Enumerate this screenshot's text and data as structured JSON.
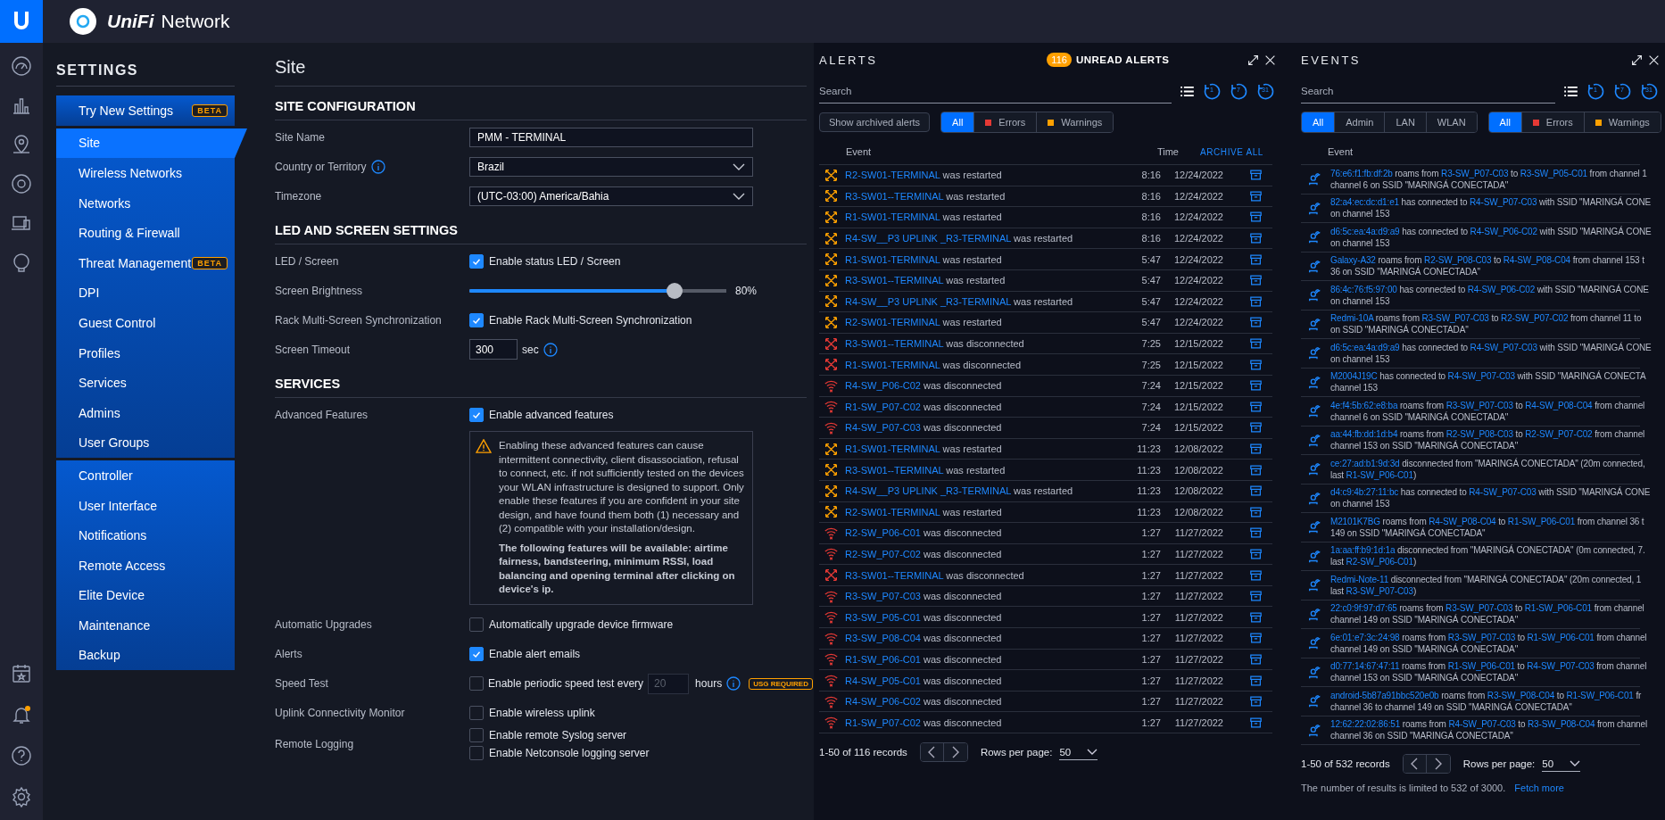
{
  "app": {
    "brand": "UniFi",
    "product": "Network"
  },
  "settings": {
    "title": "SETTINGS",
    "groups": [
      [
        {
          "label": "Try New Settings",
          "selected": false,
          "badge": "BETA"
        }
      ],
      [
        {
          "label": "Site",
          "selected": true
        },
        {
          "label": "Wireless Networks",
          "selected": false
        },
        {
          "label": "Networks",
          "selected": false
        },
        {
          "label": "Routing & Firewall",
          "selected": false
        },
        {
          "label": "Threat Management",
          "selected": false,
          "badge": "BETA"
        },
        {
          "label": "DPI",
          "selected": false
        },
        {
          "label": "Guest Control",
          "selected": false
        },
        {
          "label": "Profiles",
          "selected": false
        },
        {
          "label": "Services",
          "selected": false
        },
        {
          "label": "Admins",
          "selected": false
        },
        {
          "label": "User Groups",
          "selected": false
        }
      ],
      [
        {
          "label": "Controller",
          "selected": false
        },
        {
          "label": "User Interface",
          "selected": false
        },
        {
          "label": "Notifications",
          "selected": false
        },
        {
          "label": "Remote Access",
          "selected": false
        },
        {
          "label": "Elite Device",
          "selected": false
        },
        {
          "label": "Maintenance",
          "selected": false
        },
        {
          "label": "Backup",
          "selected": false
        }
      ]
    ]
  },
  "page": {
    "title": "Site",
    "sections": [
      {
        "title": "SITE CONFIGURATION",
        "rows": [
          {
            "kind": "text",
            "label": "Site Name",
            "value": "PMM - TERMINAL"
          },
          {
            "kind": "select",
            "label": "Country or Territory",
            "info": true,
            "value": "Brazil"
          },
          {
            "kind": "select",
            "label": "Timezone",
            "value": "(UTC-03:00) America/Bahia"
          }
        ]
      },
      {
        "title": "LED AND SCREEN SETTINGS",
        "rows": [
          {
            "kind": "checkbox",
            "label": "LED / Screen",
            "items": [
              {
                "text": "Enable status LED / Screen",
                "checked": true
              }
            ]
          },
          {
            "kind": "slider",
            "label": "Screen Brightness",
            "level": 0.8,
            "reading": "80%"
          },
          {
            "kind": "checkbox",
            "label": "Rack Multi-Screen Synchronization",
            "items": [
              {
                "text": "Enable Rack Multi-Screen Synchronization",
                "checked": true
              }
            ]
          },
          {
            "kind": "number",
            "label": "Screen Timeout",
            "value": "300",
            "unit": "sec",
            "info": true
          }
        ]
      },
      {
        "title": "SERVICES",
        "rows": [
          {
            "kind": "checkbox",
            "label": "Advanced Features",
            "items": [
              {
                "text": "Enable advanced features",
                "checked": true
              }
            ]
          },
          {
            "kind": "warning",
            "paragraphs": [
              {
                "text": "Enabling these advanced features can cause intermittent connectivity, client disassociation, refusal to connect, etc. if not sufficiently tested on the devices your WLAN infrastructure is designed to support. Only enable these features if you are confident in your site design, and have found them both (1) necessary and (2) compatible with your installation/design.",
                "strong": false
              },
              {
                "text": "The following features will be available: airtime fairness, bandsteering, minimum RSSI, load balancing and opening terminal after clicking on device's ip.",
                "strong": true
              }
            ]
          },
          {
            "kind": "checkbox",
            "label": "Automatic Upgrades",
            "items": [
              {
                "text": "Automatically upgrade device firmware",
                "checked": false
              }
            ]
          },
          {
            "kind": "checkbox",
            "label": "Alerts",
            "items": [
              {
                "text": "Enable alert emails",
                "checked": true
              }
            ]
          },
          {
            "kind": "speedtest",
            "label": "Speed Test",
            "checked": false,
            "text": "Enable periodic speed test every",
            "value": "20",
            "disabled": true,
            "unit": "hours",
            "info": true,
            "badge": "USG REQUIRED"
          },
          {
            "kind": "checkbox",
            "label": "Uplink Connectivity Monitor",
            "items": [
              {
                "text": "Enable wireless uplink",
                "checked": false
              }
            ]
          },
          {
            "kind": "checkbox",
            "label": "Remote Logging",
            "items": [
              {
                "text": "Enable remote Syslog server",
                "checked": false
              },
              {
                "text": "Enable Netconsole logging server",
                "checked": false
              }
            ]
          }
        ]
      }
    ]
  },
  "alerts": {
    "title": "ALERTS",
    "unread_count": "116",
    "unread_label": "UNREAD ALERTS",
    "search": {
      "placeholder": "Search"
    },
    "ranges": [
      "1",
      "7",
      "31"
    ],
    "archived_button": "Show archived alerts",
    "filters": [
      {
        "label": "All",
        "selected": true
      },
      {
        "label": "Errors",
        "selected": false,
        "color": "#e53935"
      },
      {
        "label": "Warnings",
        "selected": false,
        "color": "#ffa000"
      }
    ],
    "columns": [
      "Event",
      "Time"
    ],
    "archive_all": "ARCHIVE ALL",
    "rows": [
      {
        "kind": "restart",
        "device": "R2-SW01-TERMINAL",
        "text": " was restarted",
        "time": "8:16",
        "date": "12/24/2022"
      },
      {
        "kind": "restart",
        "device": "R3-SW01--TERMINAL",
        "text": " was restarted",
        "time": "8:16",
        "date": "12/24/2022"
      },
      {
        "kind": "restart",
        "device": "R1-SW01-TERMINAL",
        "text": " was restarted",
        "time": "8:16",
        "date": "12/24/2022"
      },
      {
        "kind": "restart",
        "device": "R4-SW__P3 UPLINK _R3-TERMINAL",
        "text": " was restarted",
        "time": "8:16",
        "date": "12/24/2022"
      },
      {
        "kind": "restart",
        "device": "R1-SW01-TERMINAL",
        "text": " was restarted",
        "time": "5:47",
        "date": "12/24/2022"
      },
      {
        "kind": "restart",
        "device": "R3-SW01--TERMINAL",
        "text": " was restarted",
        "time": "5:47",
        "date": "12/24/2022"
      },
      {
        "kind": "restart",
        "device": "R4-SW__P3 UPLINK _R3-TERMINAL",
        "text": " was restarted",
        "time": "5:47",
        "date": "12/24/2022"
      },
      {
        "kind": "restart",
        "device": "R2-SW01-TERMINAL",
        "text": " was restarted",
        "time": "5:47",
        "date": "12/24/2022"
      },
      {
        "kind": "disconnect",
        "device": "R3-SW01--TERMINAL",
        "text": " was disconnected",
        "time": "7:25",
        "date": "12/15/2022"
      },
      {
        "kind": "disconnect",
        "device": "R1-SW01-TERMINAL",
        "text": " was disconnected",
        "time": "7:25",
        "date": "12/15/2022"
      },
      {
        "kind": "wifi",
        "device": "R4-SW_P06-C02",
        "text": " was disconnected",
        "time": "7:24",
        "date": "12/15/2022"
      },
      {
        "kind": "wifi",
        "device": "R1-SW_P07-C02",
        "text": " was disconnected",
        "time": "7:24",
        "date": "12/15/2022"
      },
      {
        "kind": "wifi",
        "device": "R4-SW_P07-C03",
        "text": " was disconnected",
        "time": "7:24",
        "date": "12/15/2022"
      },
      {
        "kind": "restart",
        "device": "R1-SW01-TERMINAL",
        "text": " was restarted",
        "time": "11:23",
        "date": "12/08/2022"
      },
      {
        "kind": "restart",
        "device": "R3-SW01--TERMINAL",
        "text": " was restarted",
        "time": "11:23",
        "date": "12/08/2022"
      },
      {
        "kind": "restart",
        "device": "R4-SW__P3 UPLINK _R3-TERMINAL",
        "text": " was restarted",
        "time": "11:23",
        "date": "12/08/2022"
      },
      {
        "kind": "restart",
        "device": "R2-SW01-TERMINAL",
        "text": " was restarted",
        "time": "11:23",
        "date": "12/08/2022"
      },
      {
        "kind": "wifi",
        "device": "R2-SW_P06-C01",
        "text": " was disconnected",
        "time": "1:27",
        "date": "11/27/2022"
      },
      {
        "kind": "wifi",
        "device": "R2-SW_P07-C02",
        "text": " was disconnected",
        "time": "1:27",
        "date": "11/27/2022"
      },
      {
        "kind": "disconnect",
        "device": "R3-SW01--TERMINAL",
        "text": " was disconnected",
        "time": "1:27",
        "date": "11/27/2022"
      },
      {
        "kind": "wifi",
        "device": "R3-SW_P07-C03",
        "text": " was disconnected",
        "time": "1:27",
        "date": "11/27/2022"
      },
      {
        "kind": "wifi",
        "device": "R3-SW_P05-C01",
        "text": " was disconnected",
        "time": "1:27",
        "date": "11/27/2022"
      },
      {
        "kind": "wifi",
        "device": "R3-SW_P08-C04",
        "text": " was disconnected",
        "time": "1:27",
        "date": "11/27/2022"
      },
      {
        "kind": "wifi",
        "device": "R1-SW_P06-C01",
        "text": " was disconnected",
        "time": "1:27",
        "date": "11/27/2022"
      },
      {
        "kind": "wifi",
        "device": "R4-SW_P05-C01",
        "text": " was disconnected",
        "time": "1:27",
        "date": "11/27/2022"
      },
      {
        "kind": "wifi",
        "device": "R4-SW_P06-C02",
        "text": " was disconnected",
        "time": "1:27",
        "date": "11/27/2022"
      },
      {
        "kind": "wifi",
        "device": "R1-SW_P07-C02",
        "text": " was disconnected",
        "time": "1:27",
        "date": "11/27/2022"
      }
    ],
    "footer": {
      "records": "1-50 of 116 records",
      "rows_label": "Rows per page:",
      "rows_value": "50"
    }
  },
  "events": {
    "title": "EVENTS",
    "search": {
      "placeholder": "Search"
    },
    "ranges": [
      "1",
      "7",
      "31"
    ],
    "categories": [
      {
        "label": "All",
        "selected": true
      },
      {
        "label": "Admin",
        "selected": false
      },
      {
        "label": "LAN",
        "selected": false
      },
      {
        "label": "WLAN",
        "selected": false
      }
    ],
    "severities": [
      {
        "label": "All",
        "selected": true
      },
      {
        "label": "Errors",
        "selected": false,
        "color": "#e53935"
      },
      {
        "label": "Warnings",
        "selected": false,
        "color": "#ffa000"
      }
    ],
    "columns": [
      "Event"
    ],
    "rows": [
      {
        "lines": [
          [
            {
              "link": "76:e6:f1:fb:df:2b"
            },
            {
              "text": " roams from "
            },
            {
              "link": "R3-SW_P07-C03"
            },
            {
              "text": " to "
            },
            {
              "link": "R3-SW_P05-C01"
            },
            {
              "text": " from channel 1"
            }
          ],
          [
            {
              "text": "channel 6 on SSID \"MARINGÁ CONECTADA\""
            }
          ]
        ]
      },
      {
        "lines": [
          [
            {
              "link": "82:a4:ec:dc:d1:e1"
            },
            {
              "text": " has connected to "
            },
            {
              "link": "R4-SW_P07-C03"
            },
            {
              "text": " with SSID \"MARINGÁ CONE"
            }
          ],
          [
            {
              "text": "on channel 153"
            }
          ]
        ]
      },
      {
        "lines": [
          [
            {
              "link": "d6:5c:ea:4a:d9:a9"
            },
            {
              "text": " has connected to "
            },
            {
              "link": "R4-SW_P06-C02"
            },
            {
              "text": " with SSID \"MARINGÁ CONE"
            }
          ],
          [
            {
              "text": "on channel 153"
            }
          ]
        ]
      },
      {
        "lines": [
          [
            {
              "link": "Galaxy-A32"
            },
            {
              "text": " roams from "
            },
            {
              "link": "R2-SW_P08-C03"
            },
            {
              "text": " to "
            },
            {
              "link": "R4-SW_P08-C04"
            },
            {
              "text": " from channel 153 t"
            }
          ],
          [
            {
              "text": "36 on SSID \"MARINGÁ CONECTADA\""
            }
          ]
        ]
      },
      {
        "lines": [
          [
            {
              "link": "86:4c:76:f5:97:00"
            },
            {
              "text": " has connected to "
            },
            {
              "link": "R4-SW_P06-C02"
            },
            {
              "text": " with SSID \"MARINGÁ CONE"
            }
          ],
          [
            {
              "text": "on channel 153"
            }
          ]
        ]
      },
      {
        "lines": [
          [
            {
              "link": "Redmi-10A"
            },
            {
              "text": " roams from "
            },
            {
              "link": "R3-SW_P07-C03"
            },
            {
              "text": " to "
            },
            {
              "link": "R2-SW_P07-C02"
            },
            {
              "text": " from channel 11 to"
            }
          ],
          [
            {
              "text": "on SSID \"MARINGÁ CONECTADA\""
            }
          ]
        ]
      },
      {
        "lines": [
          [
            {
              "link": "d6:5c:ea:4a:d9:a9"
            },
            {
              "text": " has connected to "
            },
            {
              "link": "R4-SW_P07-C03"
            },
            {
              "text": " with SSID \"MARINGÁ CONE"
            }
          ],
          [
            {
              "text": "on channel 153"
            }
          ]
        ]
      },
      {
        "lines": [
          [
            {
              "link": "M2004J19C"
            },
            {
              "text": " has connected to "
            },
            {
              "link": "R4-SW_P07-C03"
            },
            {
              "text": " with SSID \"MARINGÁ CONECTA"
            }
          ],
          [
            {
              "text": "channel 153"
            }
          ]
        ]
      },
      {
        "lines": [
          [
            {
              "link": "4e:f4:5b:62:e8:ba"
            },
            {
              "text": " roams from "
            },
            {
              "link": "R3-SW_P07-C03"
            },
            {
              "text": " to "
            },
            {
              "link": "R4-SW_P08-C04"
            },
            {
              "text": " from channel"
            }
          ],
          [
            {
              "text": "channel 6 on SSID \"MARINGÁ CONECTADA\""
            }
          ]
        ]
      },
      {
        "lines": [
          [
            {
              "link": "aa:44:fb:dd:1d:b4"
            },
            {
              "text": " roams from "
            },
            {
              "link": "R2-SW_P08-C03"
            },
            {
              "text": " to "
            },
            {
              "link": "R2-SW_P07-C02"
            },
            {
              "text": " from channel"
            }
          ],
          [
            {
              "text": "channel 153 on SSID \"MARINGÁ CONECTADA\""
            }
          ]
        ]
      },
      {
        "lines": [
          [
            {
              "link": "ce:27:ad:b1:9d:3d"
            },
            {
              "text": " disconnected from \"MARINGÁ CONECTADA\" (20m connected,"
            }
          ],
          [
            {
              "text": "last "
            },
            {
              "link": "R1-SW_P06-C01"
            },
            {
              "text": ")"
            }
          ]
        ]
      },
      {
        "lines": [
          [
            {
              "link": "d4:c9:4b:27:11:bc"
            },
            {
              "text": " has connected to "
            },
            {
              "link": "R4-SW_P07-C03"
            },
            {
              "text": " with SSID \"MARINGÁ CONE"
            }
          ],
          [
            {
              "text": "on channel 153"
            }
          ]
        ]
      },
      {
        "lines": [
          [
            {
              "link": "M2101K7BG"
            },
            {
              "text": " roams from "
            },
            {
              "link": "R4-SW_P08-C04"
            },
            {
              "text": " to "
            },
            {
              "link": "R1-SW_P06-C01"
            },
            {
              "text": " from channel 36 t"
            }
          ],
          [
            {
              "text": "149 on SSID \"MARINGÁ CONECTADA\""
            }
          ]
        ]
      },
      {
        "lines": [
          [
            {
              "link": "1a:aa:ff:b9:1d:1a"
            },
            {
              "text": " disconnected from \"MARINGÁ CONECTADA\" (0m connected, 7."
            }
          ],
          [
            {
              "text": "last "
            },
            {
              "link": "R2-SW_P06-C01"
            },
            {
              "text": ")"
            }
          ]
        ]
      },
      {
        "lines": [
          [
            {
              "link": "Redmi-Note-11"
            },
            {
              "text": " disconnected from \"MARINGÁ CONECTADA\" (20m connected, 1"
            }
          ],
          [
            {
              "text": "last "
            },
            {
              "link": "R3-SW_P07-C03"
            },
            {
              "text": ")"
            }
          ]
        ]
      },
      {
        "lines": [
          [
            {
              "link": "22:c0:9f:97:d7:65"
            },
            {
              "text": " roams from "
            },
            {
              "link": "R3-SW_P07-C03"
            },
            {
              "text": " to "
            },
            {
              "link": "R1-SW_P06-C01"
            },
            {
              "text": " from channel"
            }
          ],
          [
            {
              "text": "channel 149 on SSID \"MARINGÁ CONECTADA\""
            }
          ]
        ]
      },
      {
        "lines": [
          [
            {
              "link": "6e:01:e7:3c:24:98"
            },
            {
              "text": " roams from "
            },
            {
              "link": "R3-SW_P07-C03"
            },
            {
              "text": " to "
            },
            {
              "link": "R1-SW_P06-C01"
            },
            {
              "text": " from channel"
            }
          ],
          [
            {
              "text": "channel 149 on SSID \"MARINGÁ CONECTADA\""
            }
          ]
        ]
      },
      {
        "lines": [
          [
            {
              "link": "d0:77:14:67:47:11"
            },
            {
              "text": " roams from "
            },
            {
              "link": "R1-SW_P06-C01"
            },
            {
              "text": " to "
            },
            {
              "link": "R4-SW_P07-C03"
            },
            {
              "text": " from channel"
            }
          ],
          [
            {
              "text": "channel 153 on SSID \"MARINGÁ CONECTADA\""
            }
          ]
        ]
      },
      {
        "lines": [
          [
            {
              "link": "android-5b87a91bbc520e0b"
            },
            {
              "text": " roams from "
            },
            {
              "link": "R3-SW_P08-C04"
            },
            {
              "text": " to "
            },
            {
              "link": "R1-SW_P06-C01"
            },
            {
              "text": " fr"
            }
          ],
          [
            {
              "text": "channel 36 to channel 149 on SSID \"MARINGÁ CONECTADA\""
            }
          ]
        ]
      },
      {
        "lines": [
          [
            {
              "link": "12:62:22:02:86:51"
            },
            {
              "text": " roams from "
            },
            {
              "link": "R4-SW_P07-C03"
            },
            {
              "text": " to "
            },
            {
              "link": "R3-SW_P08-C04"
            },
            {
              "text": " from channel"
            }
          ],
          [
            {
              "text": "channel 36 on SSID \"MARINGÁ CONECTADA\""
            }
          ]
        ]
      }
    ],
    "footer": {
      "records": "1-50 of 532 records",
      "rows_label": "Rows per page:",
      "rows_value": "50",
      "note": "The number of results is limited to 532 of 3000.",
      "fetch_more": "Fetch more"
    }
  }
}
